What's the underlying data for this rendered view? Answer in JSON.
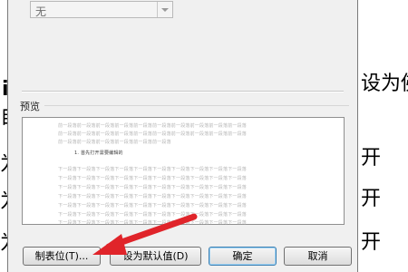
{
  "background_doc": {
    "glyphs": [
      "i",
      "自",
      "为",
      "为",
      "为"
    ],
    "side_texts": [
      "设为佛",
      "开",
      "开",
      "开"
    ]
  },
  "dialog": {
    "combo": {
      "value": "无"
    },
    "preview": {
      "label": "预览",
      "prev_para": [
        "前一段落前一段落前一段落前一段落前一段落前一段落前一段落前一段落前一段落前一段落",
        "前一段落前一段落前一段落前一段落前一段落前一段落前一段落前一段落前一段落前一段落",
        "前一段落前一段落前一段落前一段落前一段落前一段落"
      ],
      "current_para": "1. 首先打开需要编辑的",
      "next_para": [
        "下一段落下一段落下一段落下一段落下一段落下一段落下一段落下一段落下一段落下一段落",
        "下一段落下一段落下一段落下一段落下一段落下一段落下一段落下一段落下一段落下一段落",
        "下一段落下一段落下一段落下一段落下一段落下一段落下一段落下一段落下一段落下一段落",
        "下一段落下一段落下一段落下一段落下一段落下一段落下一段落下一段落下一段落下一段落",
        "下一段落下一段落下一段落下一段落下一段落下一段落下一段落下一段落下一段落下一段落",
        "下一段落下一段落下一段落下一段落下一段落下一段落下一段落下一段落下一段落下一段落",
        "下一段落下一段落下一段落下一段落下一段落下一段落下一段落下一段落下一段落下一段落"
      ]
    },
    "buttons": {
      "tabs": "制表位(T)...",
      "set_default": "设为默认值(D)",
      "ok": "确定",
      "cancel": "取消"
    }
  },
  "colors": {
    "dialog_bg": "#f0f0f0",
    "annotation_arrow": "#e0242a"
  },
  "icons": {
    "combo_dropdown": "chevron-down-icon",
    "annotation": "red-arrow-icon"
  }
}
